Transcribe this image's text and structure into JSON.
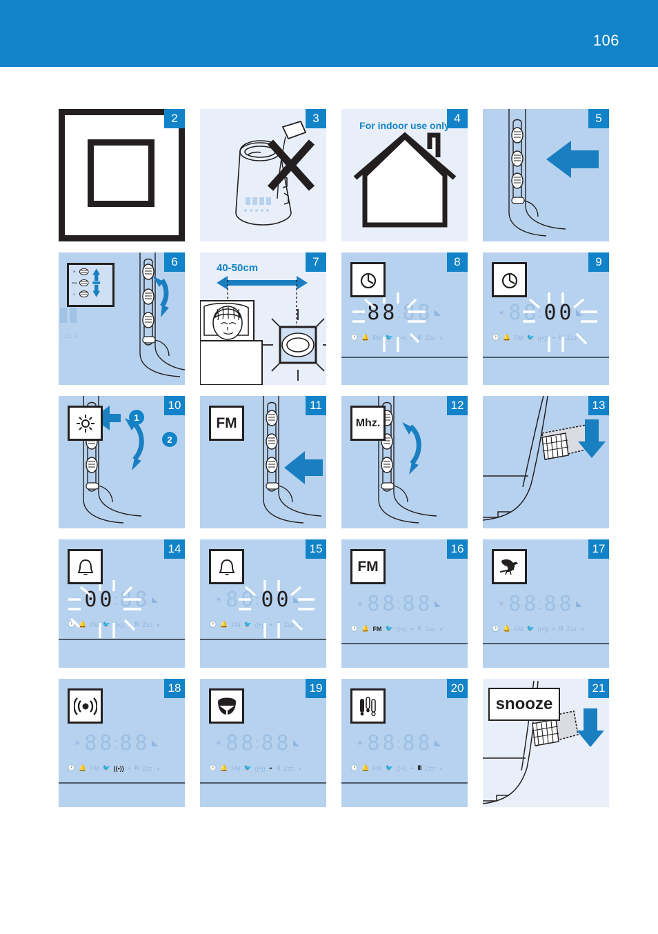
{
  "header": {
    "page_number": "106",
    "background_color": "#1283c8"
  },
  "colors": {
    "brand_blue": "#1283c8",
    "panel_pale": "#e8eff9",
    "panel_mid": "#b7d2ee",
    "ink": "#231f20",
    "lcd_off": "#9dc0e4"
  },
  "panels": [
    {
      "number": "2",
      "kind": "symbol",
      "symbol": "class-ii-double-square",
      "background": "white",
      "caption": ""
    },
    {
      "number": "3",
      "kind": "illustration",
      "symbol": "no-liquid-cross",
      "background": "pale",
      "caption": ""
    },
    {
      "number": "4",
      "kind": "symbol",
      "symbol": "house-icon",
      "background": "pale",
      "caption": "For indoor use only"
    },
    {
      "number": "5",
      "kind": "illustration",
      "symbol": "press-button-arrow",
      "background": "mid",
      "caption": ""
    },
    {
      "number": "6",
      "kind": "illustration",
      "symbol": "updown-buttons-inset",
      "background": "mid",
      "caption": ""
    },
    {
      "number": "7",
      "kind": "illustration",
      "symbol": "distance-bed-device",
      "background": "pale",
      "caption": "40-50cm"
    },
    {
      "number": "8",
      "kind": "lcd",
      "icon_label": "clock-icon",
      "background": "mid",
      "digits": [
        "8",
        "8",
        "8",
        "8"
      ],
      "digits_on": [
        true,
        true,
        false,
        false
      ],
      "flashing": true,
      "active_indicator": "clock",
      "indicator_on": false
    },
    {
      "number": "9",
      "kind": "lcd",
      "icon_label": "clock-icon",
      "background": "mid",
      "digits": [
        "8",
        "8",
        "0",
        "0"
      ],
      "digits_on": [
        false,
        false,
        true,
        true
      ],
      "flashing": true,
      "active_indicator": "clock",
      "indicator_on": true
    },
    {
      "number": "10",
      "kind": "illustration",
      "symbol": "sun-brightness-icon",
      "background": "mid",
      "caption": "",
      "steps": [
        "1",
        "2"
      ]
    },
    {
      "number": "11",
      "kind": "illustration",
      "symbol": "fm-badge",
      "background": "mid",
      "icon_text": "FM"
    },
    {
      "number": "12",
      "kind": "illustration",
      "symbol": "mhz-badge",
      "background": "mid",
      "icon_text": "Mhz."
    },
    {
      "number": "13",
      "kind": "illustration",
      "symbol": "press-top-down-arrow",
      "background": "mid"
    },
    {
      "number": "14",
      "kind": "lcd",
      "icon_label": "bell-icon",
      "background": "mid",
      "digits": [
        "0",
        "0",
        "8",
        "8"
      ],
      "digits_on": [
        true,
        true,
        false,
        false
      ],
      "flashing": true,
      "active_indicator": "bell",
      "indicator_on": true
    },
    {
      "number": "15",
      "kind": "lcd",
      "icon_label": "bell-icon",
      "background": "mid",
      "digits": [
        "8",
        "0",
        "0",
        "0"
      ],
      "digits_on": [
        false,
        false,
        true,
        true
      ],
      "flashing": true,
      "active_indicator": "bell",
      "indicator_on": false
    },
    {
      "number": "16",
      "kind": "lcd",
      "icon_label": "fm-badge",
      "icon_text": "FM",
      "background": "mid",
      "digits": [
        "8",
        "8",
        "8",
        "8"
      ],
      "digits_on": [
        false,
        false,
        false,
        false
      ],
      "flashing": false,
      "active_indicator": "fm",
      "indicator_on": true
    },
    {
      "number": "17",
      "kind": "lcd",
      "icon_label": "bird-icon",
      "background": "mid",
      "digits": [
        "8",
        "8",
        "8",
        "8"
      ],
      "digits_on": [
        false,
        false,
        false,
        false
      ],
      "flashing": false,
      "active_indicator": "bird",
      "indicator_on": true
    },
    {
      "number": "18",
      "kind": "lcd",
      "icon_label": "beep-icon",
      "background": "mid",
      "digits": [
        "8",
        "8",
        "8",
        "8"
      ],
      "digits_on": [
        false,
        false,
        false,
        false
      ],
      "flashing": false,
      "active_indicator": "beep",
      "indicator_on": true
    },
    {
      "number": "19",
      "kind": "lcd",
      "icon_label": "drum-icon",
      "background": "mid",
      "digits": [
        "8",
        "8",
        "8",
        "8"
      ],
      "digits_on": [
        false,
        false,
        false,
        false
      ],
      "flashing": false,
      "active_indicator": "drum",
      "indicator_on": true
    },
    {
      "number": "20",
      "kind": "lcd",
      "icon_label": "chimes-icon",
      "background": "mid",
      "digits": [
        "8",
        "8",
        "8",
        "8"
      ],
      "digits_on": [
        false,
        false,
        false,
        false
      ],
      "flashing": false,
      "active_indicator": "chimes",
      "indicator_on": true
    },
    {
      "number": "21",
      "kind": "illustration",
      "symbol": "snooze-press",
      "background": "pale",
      "icon_text": "snooze"
    }
  ],
  "lcd_indicators": [
    {
      "name": "clock",
      "glyph": "clock-icon"
    },
    {
      "name": "bell",
      "glyph": "bell-icon"
    },
    {
      "name": "fm",
      "glyph": "FM"
    },
    {
      "name": "bird",
      "glyph": "bird-icon"
    },
    {
      "name": "beep",
      "glyph": "beep-icon"
    },
    {
      "name": "drum",
      "glyph": "drum-icon"
    },
    {
      "name": "chimes",
      "glyph": "chimes-icon"
    },
    {
      "name": "zzz",
      "glyph": "Zzz"
    },
    {
      "name": "dimmer",
      "glyph": "half-moon-icon"
    }
  ],
  "panel_labels": {
    "indoor_only": "For indoor use only",
    "distance": "40-50cm",
    "fm": "FM",
    "mhz": "Mhz.",
    "snooze": "snooze",
    "step_one": "1",
    "step_two": "2"
  }
}
